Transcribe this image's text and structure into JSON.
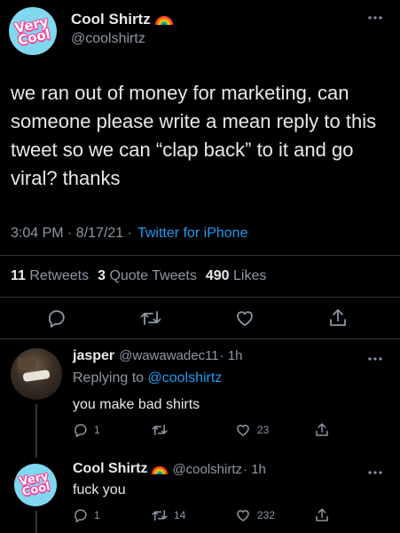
{
  "main_tweet": {
    "display_name": "Cool Shirtz",
    "handle": "@coolshirtz",
    "avatar_text": [
      "Very",
      "Cool"
    ],
    "text": "we ran out of money for marketing, can someone please write a mean reply to this tweet so we can “clap back” to it and go viral? thanks",
    "time": "3:04 PM · 8/17/21 ·",
    "source": "Twitter for iPhone",
    "stats": {
      "retweets_count": "11",
      "retweets_label": "Retweets",
      "quotes_count": "3",
      "quotes_label": "Quote Tweets",
      "likes_count": "490",
      "likes_label": "Likes"
    }
  },
  "replies": [
    {
      "display_name": "jasper",
      "handle": "@wawawadec11",
      "time": "· 1h",
      "replying_prefix": "Replying to",
      "replying_to": "@coolshirtz",
      "text": "you make bad shirts",
      "reply_count": "1",
      "retweet_count": "",
      "like_count": "23"
    },
    {
      "display_name": "Cool Shirtz",
      "handle": "@coolshirtz",
      "time": "· 1h",
      "avatar_text": [
        "Very",
        "Cool"
      ],
      "text": "fuck you",
      "reply_count": "1",
      "retweet_count": "14",
      "like_count": "232"
    }
  ],
  "icons": {
    "reply": "reply-icon",
    "retweet": "retweet-icon",
    "like": "heart-icon",
    "share": "share-icon",
    "more": "more-icon",
    "verified_badge": "rainbow-emoji"
  },
  "colors": {
    "background": "#000000",
    "text": "#e7e9ea",
    "muted": "#8b98a5",
    "link": "#1d9bf0",
    "avatar_bg": "#7fd8ef",
    "avatar_accent": "#ff3e9a"
  }
}
